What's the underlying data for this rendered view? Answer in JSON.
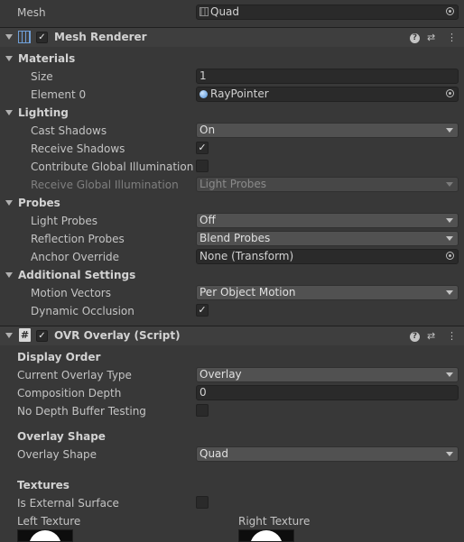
{
  "mesh_filter": {
    "mesh_label": "Mesh",
    "mesh_value": "Quad"
  },
  "mesh_renderer": {
    "title": "Mesh Renderer",
    "materials": {
      "header": "Materials",
      "size_label": "Size",
      "size_value": "1",
      "element0_label": "Element 0",
      "element0_value": "RayPointer"
    },
    "lighting": {
      "header": "Lighting",
      "cast_shadows_label": "Cast Shadows",
      "cast_shadows_value": "On",
      "receive_shadows_label": "Receive Shadows",
      "receive_shadows_checked": true,
      "contribute_gi_label": "Contribute Global Illumination",
      "contribute_gi_checked": false,
      "receive_gi_label": "Receive Global Illumination",
      "receive_gi_value": "Light Probes"
    },
    "probes": {
      "header": "Probes",
      "light_probes_label": "Light Probes",
      "light_probes_value": "Off",
      "reflection_probes_label": "Reflection Probes",
      "reflection_probes_value": "Blend Probes",
      "anchor_override_label": "Anchor Override",
      "anchor_override_value": "None (Transform)"
    },
    "additional": {
      "header": "Additional Settings",
      "motion_vectors_label": "Motion Vectors",
      "motion_vectors_value": "Per Object Motion",
      "dynamic_occlusion_label": "Dynamic Occlusion",
      "dynamic_occlusion_checked": true
    }
  },
  "ovr_overlay": {
    "title": "OVR Overlay (Script)",
    "display_order_header": "Display Order",
    "current_overlay_type_label": "Current Overlay Type",
    "current_overlay_type_value": "Overlay",
    "composition_depth_label": "Composition Depth",
    "composition_depth_value": "0",
    "no_depth_buffer_label": "No Depth Buffer Testing",
    "no_depth_buffer_checked": false,
    "overlay_shape_header": "Overlay Shape",
    "overlay_shape_label": "Overlay Shape",
    "overlay_shape_value": "Quad",
    "textures_header": "Textures",
    "is_external_surface_label": "Is External Surface",
    "is_external_surface_checked": false,
    "left_texture_label": "Left Texture",
    "right_texture_label": "Right Texture"
  },
  "icons": {
    "check": "✓",
    "help": "?",
    "preset": "⇄",
    "more": "⋮",
    "script": "#"
  }
}
